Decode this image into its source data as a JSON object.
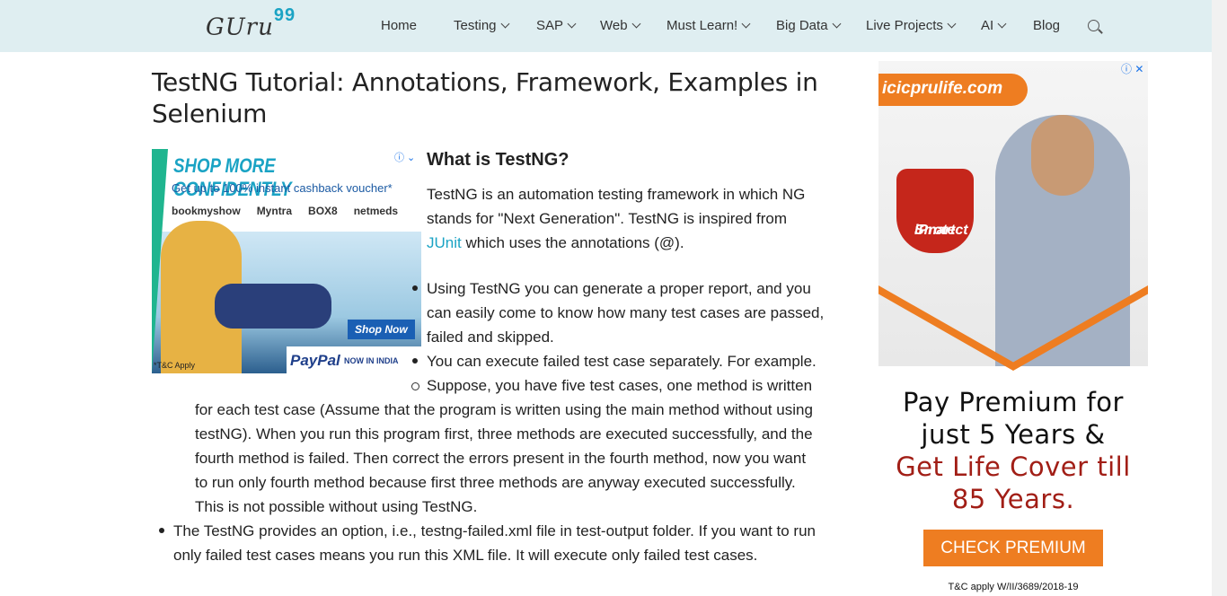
{
  "header": {
    "logo_text": "GUru",
    "logo_num": "99",
    "nav": [
      "Home",
      "Testing",
      "SAP",
      "Web",
      "Must Learn!",
      "Big Data",
      "Live Projects",
      "AI",
      "Blog"
    ]
  },
  "article": {
    "title": "TestNG Tutorial: Annotations, Framework, Examples in Selenium",
    "heading": "What is TestNG?",
    "intro_1": "TestNG is an automation testing framework in which NG",
    "intro_2": "stands for \"Next Generation\". TestNG is inspired from",
    "intro_link": "JUnit",
    "intro_3": " which uses the annotations (@).",
    "b1_l1": "Using TestNG you can generate a proper report, and you",
    "b1_l2": "can easily come to know how many test cases are passed,",
    "b1_l3": "failed and skipped.",
    "b2": "You can execute failed test case separately. For example.",
    "s1_l1": "Suppose, you have five test cases, one method is written",
    "s1_l2": "for each test case (Assume that the program is written using the main method without using",
    "s1_l3": "testNG). When you run this program first, three methods are executed successfully, and the",
    "s1_l4": "fourth method is failed. Then correct the errors present in the fourth method, now you want",
    "s1_l5": "to run only fourth method because first three methods are anyway executed successfully.",
    "s1_l6": "This is not possible without using TestNG.",
    "b3_l1": "The TestNG provides an option, i.e., testng-failed.xml file in test-output folder. If you want to run",
    "b3_l2": "only failed test cases means you run this XML file. It will execute only failed test cases."
  },
  "ad_left": {
    "headline": "SHOP MORE CONFIDENTLY",
    "sub": "Get up to 100% instant cashback voucher*",
    "brands": [
      "bookmyshow",
      "Myntra",
      "BOX8",
      "netmeds"
    ],
    "shop_now": "Shop Now",
    "paypal": "PayPal",
    "paypal_sub": "NOW IN INDIA",
    "tc": "*T&C Apply"
  },
  "ad_right": {
    "url": "icicprulife.com",
    "badge_1": "iProtect",
    "badge_2": "Smart",
    "line1": "Pay Premium for",
    "line2": "just 5 Years &",
    "line3": "Get Life Cover till",
    "line4": "85 Years.",
    "cta": "CHECK PREMIUM",
    "tc": "T&C apply W/II/3689/2018-19"
  }
}
